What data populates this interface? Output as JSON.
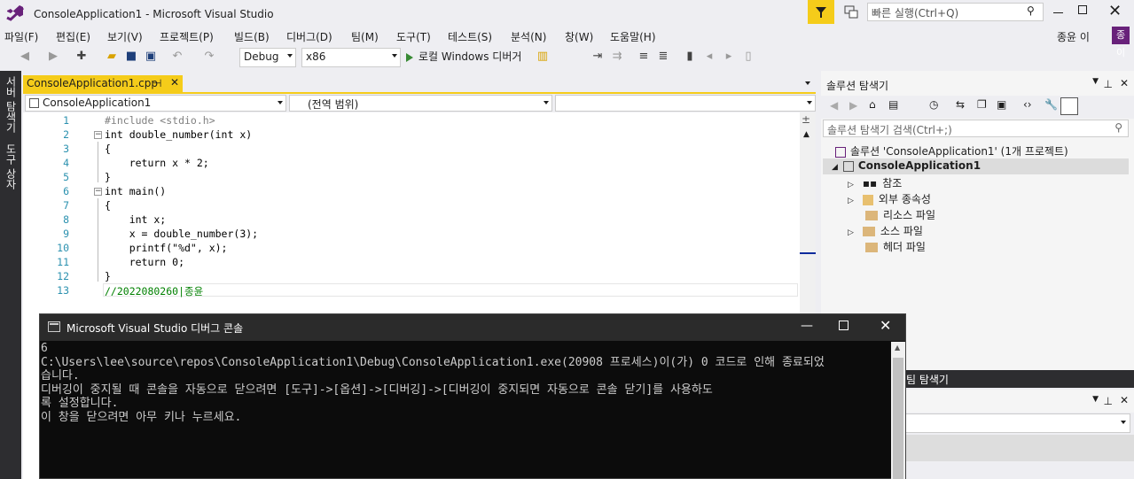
{
  "window": {
    "title": "ConsoleApplication1 - Microsoft Visual Studio",
    "quick_launch_placeholder": "빠른 실행(Ctrl+Q)",
    "user_name": "종윤 이",
    "user_avatar": "종이",
    "accent": "#f5cc1a"
  },
  "menu": [
    "파일(F)",
    "편집(E)",
    "보기(V)",
    "프로젝트(P)",
    "빌드(B)",
    "디버그(D)",
    "팀(M)",
    "도구(T)",
    "테스트(S)",
    "분석(N)",
    "창(W)",
    "도움말(H)"
  ],
  "toolbar": {
    "config": "Debug",
    "platform": "x86",
    "run_label": "로컬 Windows 디버거"
  },
  "left_strip": {
    "server_explorer": "서버 탐색기",
    "toolbox": "도구 상자"
  },
  "editor": {
    "tab_name": "ConsoleApplication1.cpp",
    "project_combo": "ConsoleApplication1",
    "scope_combo": "(전역 범위)",
    "line_numbers": [
      "1",
      "2",
      "3",
      "4",
      "5",
      "6",
      "7",
      "8",
      "9",
      "10",
      "11",
      "12",
      "13"
    ],
    "lines": [
      "#include <stdio.h>",
      "int double_number(int x)",
      "{",
      "    return x * 2;",
      "}",
      "int main()",
      "{",
      "    int x;",
      "    x = double_number(3);",
      "    printf(\"%d\", x);",
      "    return 0;",
      "}",
      "//2022080260|종윤"
    ]
  },
  "solution_explorer": {
    "title": "솔루션 탐색기",
    "search_placeholder": "솔루션 탐색기 검색(Ctrl+;)",
    "solution": "솔루션 'ConsoleApplication1' (1개 프로젝트)",
    "project": "ConsoleApplication1",
    "items": [
      "참조",
      "외부 종속성",
      "리소스 파일",
      "소스 파일",
      "헤더 파일"
    ]
  },
  "team_tab": "팀 탐색기",
  "console": {
    "title": "Microsoft Visual Studio 디버그 콘솔",
    "lines": [
      "6",
      "C:\\Users\\lee\\source\\repos\\ConsoleApplication1\\Debug\\ConsoleApplication1.exe(20908 프로세스)이(가) 0 코드로 인해 종료되었",
      "습니다.",
      "디버깅이 중지될 때 콘솔을 자동으로 닫으려면 [도구]->[옵션]->[디버깅]->[디버깅이 중지되면 자동으로 콘솔 닫기]를 사용하도",
      "록 설정합니다.",
      "이 창을 닫으려면 아무 키나 누르세요."
    ]
  }
}
